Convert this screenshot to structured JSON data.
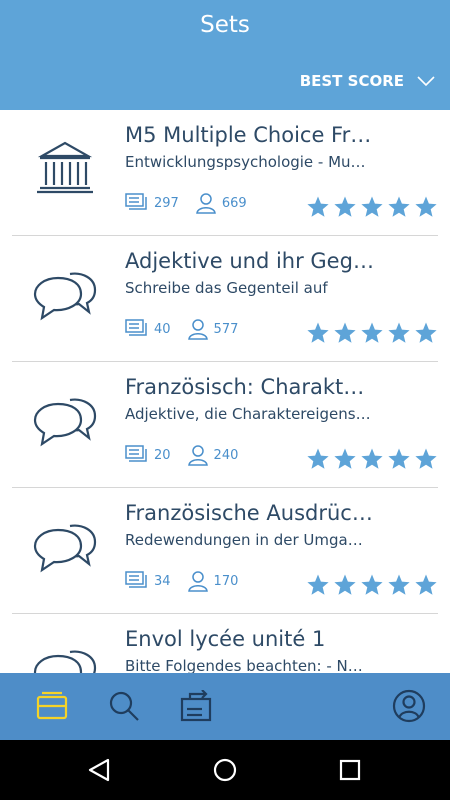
{
  "header": {
    "title": "Sets",
    "sort_label": "BEST SCORE"
  },
  "sets": [
    {
      "icon": "museum-icon",
      "title": "M5 Multiple Choice Fr…",
      "subtitle": "Entwicklungspsychologie - Mu…",
      "terms": "297",
      "users": "669",
      "rating": 5
    },
    {
      "icon": "speech-bubbles-icon",
      "title": "Adjektive und ihr Gege…",
      "subtitle": "Schreibe das Gegenteil auf",
      "terms": "40",
      "users": "577",
      "rating": 5
    },
    {
      "icon": "speech-bubbles-icon",
      "title": "Französisch: Charakte…",
      "subtitle": "Adjektive, die Charaktereigens…",
      "terms": "20",
      "users": "240",
      "rating": 5
    },
    {
      "icon": "speech-bubbles-icon",
      "title": "Französische Ausdrüc…",
      "subtitle": "Redewendungen in der Umga…",
      "terms": "34",
      "users": "170",
      "rating": 5
    },
    {
      "icon": "speech-bubbles-icon",
      "title": "Envol lycée unité 1",
      "subtitle": "Bitte Folgendes beachten: - N…",
      "terms": "",
      "users": "",
      "rating": 0
    }
  ],
  "nav": [
    {
      "name": "sets-tab-icon",
      "active": true
    },
    {
      "name": "search-icon",
      "active": false
    },
    {
      "name": "import-icon",
      "active": false
    },
    {
      "name": "profile-icon",
      "active": false
    }
  ],
  "colors": {
    "header": "#5ea4d8",
    "nav": "#4e8dc8",
    "active_nav": "#f5d328",
    "title_text": "#2e4a66",
    "accent": "#4a8fcb",
    "star": "#5ea4d8"
  }
}
